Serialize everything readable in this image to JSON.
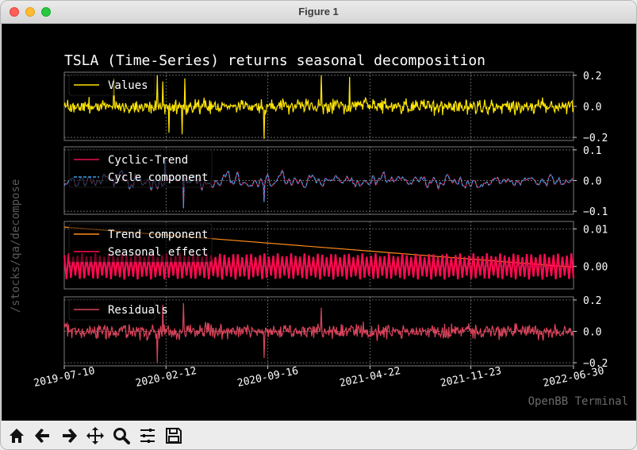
{
  "window": {
    "title": "Figure 1"
  },
  "chart_data": {
    "type": "line",
    "title": "TSLA (Time-Series) returns seasonal decomposition",
    "ylabel": "/stocks/qa/decompose",
    "watermark": "OpenBB Terminal",
    "x_ticks": [
      "2019-07-10",
      "2020-02-12",
      "2020-09-16",
      "2021-04-22",
      "2021-11-23",
      "2022-06-30"
    ],
    "x_range": [
      "2019-07-10",
      "2022-06-30"
    ],
    "grid": true,
    "panels": [
      {
        "id": "values",
        "legend_placement": "top-left",
        "ylim": [
          -0.22,
          0.22
        ],
        "yticks": [
          {
            "value": 0.2,
            "label": "0.2"
          },
          {
            "value": 0.0,
            "label": "0.0"
          },
          {
            "value": -0.2,
            "label": "−0.2"
          }
        ],
        "series": [
          {
            "name": "Values",
            "color": "#ffe600",
            "style": "solid",
            "amplitude": 0.045,
            "spikes": [
              {
                "date": "2019-10-24",
                "value": 0.18
              },
              {
                "date": "2020-01-24",
                "value": 0.2
              },
              {
                "date": "2020-02-05",
                "value": 0.16
              },
              {
                "date": "2020-02-19",
                "value": -0.17
              },
              {
                "date": "2020-03-18",
                "value": -0.18
              },
              {
                "date": "2020-03-23",
                "value": 0.18
              },
              {
                "date": "2020-09-08",
                "value": -0.21
              },
              {
                "date": "2021-01-08",
                "value": 0.2
              },
              {
                "date": "2021-03-09",
                "value": 0.19
              }
            ]
          }
        ]
      },
      {
        "id": "cycle",
        "legend_placement": "top-left",
        "ylim": [
          -0.11,
          0.11
        ],
        "yticks": [
          {
            "value": 0.1,
            "label": "0.1"
          },
          {
            "value": 0.0,
            "label": "0.0"
          },
          {
            "value": -0.1,
            "label": "−0.1"
          }
        ],
        "series": [
          {
            "name": "Cyclic-Trend",
            "color": "#e8114a",
            "style": "solid",
            "amplitude": 0.025,
            "spikes": [
              {
                "date": "2020-03-20",
                "value": -0.09
              },
              {
                "date": "2020-02-10",
                "value": 0.07
              },
              {
                "date": "2020-09-08",
                "value": -0.07
              }
            ]
          },
          {
            "name": "Cycle component",
            "color": "#3aa0e8",
            "style": "dashed",
            "amplitude": 0.025,
            "spikes": [
              {
                "date": "2020-03-20",
                "value": -0.09
              },
              {
                "date": "2020-02-10",
                "value": 0.07
              },
              {
                "date": "2020-09-08",
                "value": -0.07
              }
            ]
          }
        ]
      },
      {
        "id": "trend",
        "legend_placement": "top-left",
        "ylim": [
          -0.006,
          0.012
        ],
        "yticks": [
          {
            "value": 0.01,
            "label": "0.01"
          },
          {
            "value": 0.0,
            "label": "0.00"
          }
        ],
        "series": [
          {
            "name": "Trend component",
            "color": "#ff8c1a",
            "style": "solid",
            "points": [
              {
                "date": "2019-07-10",
                "value": 0.0105
              },
              {
                "date": "2022-06-30",
                "value": -0.0002
              }
            ]
          },
          {
            "name": "Seasonal effect",
            "color": "#ff0a50",
            "style": "solid",
            "amplitude": 0.0035,
            "band": true
          }
        ]
      },
      {
        "id": "residuals",
        "legend_placement": "top-left",
        "ylim": [
          -0.22,
          0.22
        ],
        "yticks": [
          {
            "value": 0.2,
            "label": "0.2"
          },
          {
            "value": 0.0,
            "label": "0.0"
          },
          {
            "value": -0.2,
            "label": "−0.2"
          }
        ],
        "series": [
          {
            "name": "Residuals",
            "color": "#d9435a",
            "style": "solid",
            "amplitude": 0.045,
            "spikes": [
              {
                "date": "2020-01-24",
                "value": -0.2
              },
              {
                "date": "2020-02-05",
                "value": 0.17
              },
              {
                "date": "2020-03-20",
                "value": 0.18
              },
              {
                "date": "2020-09-08",
                "value": -0.17
              },
              {
                "date": "2021-01-08",
                "value": 0.15
              }
            ]
          }
        ]
      }
    ]
  },
  "toolbar": {
    "buttons": [
      {
        "name": "home-icon",
        "label": "Home"
      },
      {
        "name": "back-icon",
        "label": "Back"
      },
      {
        "name": "forward-icon",
        "label": "Forward"
      },
      {
        "name": "pan-icon",
        "label": "Pan"
      },
      {
        "name": "zoom-icon",
        "label": "Zoom"
      },
      {
        "name": "configure-subplots-icon",
        "label": "Configure subplots"
      },
      {
        "name": "save-icon",
        "label": "Save"
      }
    ]
  }
}
